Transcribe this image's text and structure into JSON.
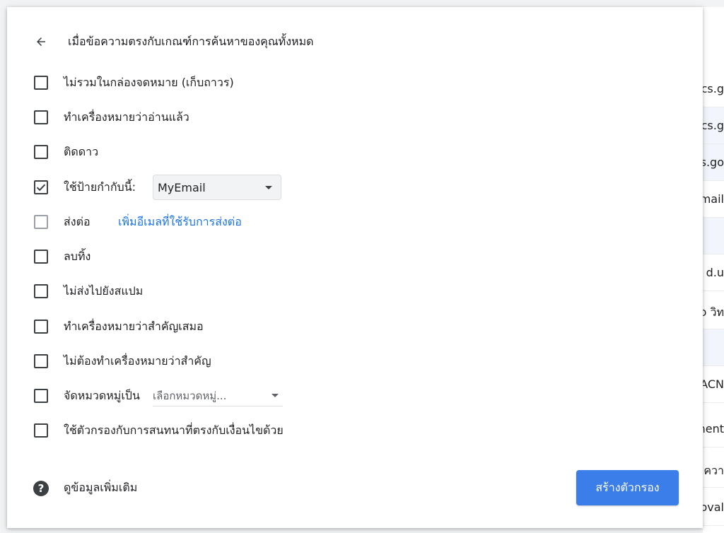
{
  "background_list": {
    "rows": [
      {
        "text": "cs.g"
      },
      {
        "text": "cs.g"
      },
      {
        "text": "s.go"
      },
      {
        "text": "mail"
      },
      {
        "text": ""
      },
      {
        "text": "d.u"
      },
      {
        "text": "o วิท"
      },
      {
        "text": ""
      },
      {
        "text": "ACN"
      },
      {
        "text": "nent"
      },
      {
        "text": "ควา"
      },
      {
        "text": "oval"
      }
    ]
  },
  "dialog": {
    "title": "เมื่อข้อความตรงกับเกณฑ์การค้นหาของคุณทั้งหมด",
    "options": [
      {
        "label": "ไม่รวมในกล่องจดหมาย (เก็บถาวร)",
        "checked": false
      },
      {
        "label": "ทำเครื่องหมายว่าอ่านแล้ว",
        "checked": false
      },
      {
        "label": "ติดดาว",
        "checked": false
      },
      {
        "label": "ใช้ป้ายกำกับนี้:",
        "checked": true,
        "select_value": "MyEmail"
      },
      {
        "label": "ส่งต่อ",
        "checked": false,
        "disabled": true,
        "link": "เพิ่มอีเมลที่ใช้รับการส่งต่อ"
      },
      {
        "label": "ลบทิ้ง",
        "checked": false
      },
      {
        "label": "ไม่ส่งไปยังสแปม",
        "checked": false
      },
      {
        "label": "ทำเครื่องหมายว่าสำคัญเสมอ",
        "checked": false
      },
      {
        "label": "ไม่ต้องทำเครื่องหมายว่าสำคัญ",
        "checked": false
      },
      {
        "label": "จัดหมวดหมู่เป็น",
        "checked": false,
        "select_value": "เลือกหมวดหมู่..."
      },
      {
        "label": "ใช้ตัวกรองกับการสนทนาที่ตรงกับเงื่อนไขด้วย",
        "checked": false
      }
    ],
    "help_text": "ดูข้อมูลเพิ่มเติม",
    "create_button": "สร้างตัวกรอง"
  },
  "colors": {
    "primary_button": "#3b7de9",
    "link": "#1a73e8",
    "text": "#202124"
  }
}
